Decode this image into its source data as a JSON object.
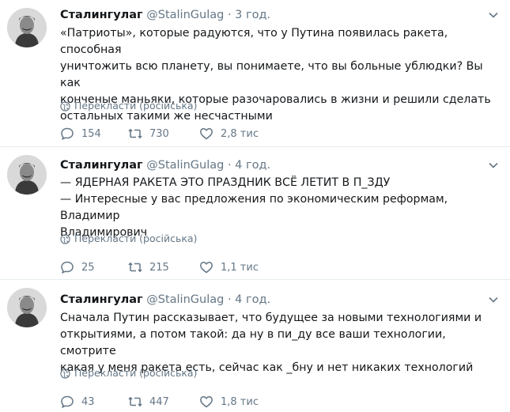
{
  "tweets": [
    {
      "name": "Сталингулаг",
      "handle": "@StalinGulag",
      "dot": "·",
      "time": "3 год.",
      "lines": [
        "«Патриоты», которые радуются, что у Путина появилась ракета, способная",
        "уничтожить всю планету, вы понимаете, что вы больные ублюдки? Вы как",
        "конченые маньяки, которые разочаровались в жизни и решили сделать",
        "остальных такими же несчастными"
      ],
      "translate": "Перекласти (російська)",
      "replies": "154",
      "retweets": "730",
      "likes": "2,8 тис"
    },
    {
      "name": "Сталингулаг",
      "handle": "@StalinGulag",
      "dot": "·",
      "time": "4 год.",
      "lines": [
        "— ЯДЕРНАЯ РАКЕТА ЭТО ПРАЗДНИК ВСЁ ЛЕТИТ В П_ЗДУ",
        "— Интересные у вас предложения по экономическим реформам, Владимир",
        "Владимирович"
      ],
      "translate": "Перекласти (російська)",
      "replies": "25",
      "retweets": "215",
      "likes": "1,1 тис"
    },
    {
      "name": "Сталингулаг",
      "handle": "@StalinGulag",
      "dot": "·",
      "time": "4 год.",
      "lines": [
        "Сначала Путин рассказывает, что будущее за новыми технологиями и",
        "открытиями, а потом такой: да ну в пи_ду все ваши технологии, смотрите",
        "какая у меня ракета есть, сейчас как _бну и нет никаких технологий"
      ],
      "translate": "Перекласти (російська)",
      "replies": "43",
      "retweets": "447",
      "likes": "1,8 тис"
    }
  ],
  "icons": {
    "reply": "reply-icon",
    "retweet": "retweet-icon",
    "like": "heart-icon",
    "translate": "globe-icon",
    "more": "chevron-down-icon"
  },
  "colors": {
    "text": "#14171a",
    "secondary": "#657786",
    "divider": "#e6ecf0"
  }
}
